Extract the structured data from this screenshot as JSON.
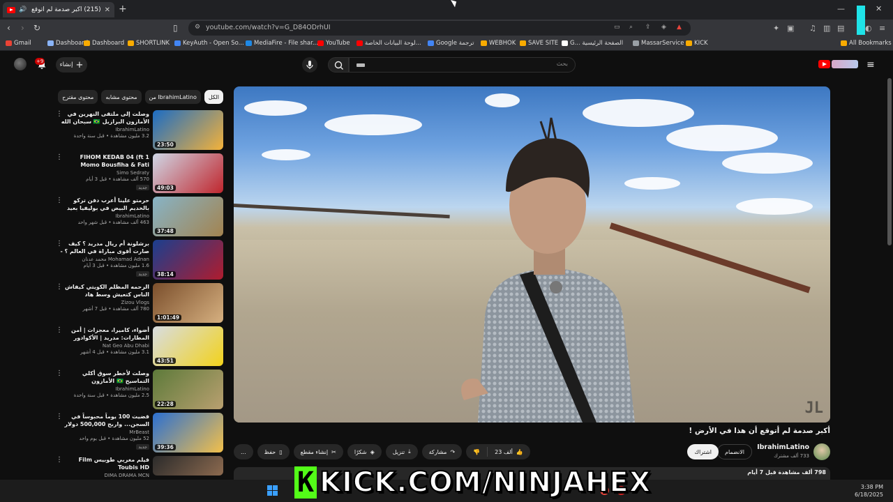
{
  "browser": {
    "tab_title": "(215) أكبر صدمة لم أتوقع أن هذا في الأرض !",
    "url": "youtube.com/watch?v=G_D84ODrhUI",
    "bookmarks": [
      {
        "label": "Gmail",
        "color": "#ea4335"
      },
      {
        "label": "Dashboard",
        "color": "#8ab4f8"
      },
      {
        "label": "Dashboard",
        "color": "#f9ab00"
      },
      {
        "label": "SHORTLINK",
        "color": "#f9ab00"
      },
      {
        "label": "KeyAuth - Open So...",
        "color": "#4285f4"
      },
      {
        "label": "MediaFire - File shar...",
        "color": "#1e88e5"
      },
      {
        "label": "YouTube",
        "color": "#ff0000"
      },
      {
        "label": "لوحة البيانات الخاصة...",
        "color": "#ff0000"
      },
      {
        "label": "Google ترجمة",
        "color": "#4285f4"
      },
      {
        "label": "WEBHOK",
        "color": "#f9ab00"
      },
      {
        "label": "SAVE SITE",
        "color": "#f9ab00"
      },
      {
        "label": "G... الصفحة الرئيسية",
        "color": "#ffffff"
      },
      {
        "label": "MassarService",
        "color": "#9aa0a6"
      },
      {
        "label": "KICK",
        "color": "#f9ab00"
      },
      {
        "label": "All Bookmarks",
        "color": "#f9ab00"
      }
    ]
  },
  "masthead": {
    "search_placeholder": "بحث",
    "create_label": "إنشاء",
    "notifications": "+9"
  },
  "chips": [
    "الكل",
    "من IbrahimLatino",
    "محتوى مشابه",
    "محتوى مقترح"
  ],
  "related": [
    {
      "title": "وصلت إلى ملتقى النهرين في الأمازون البرازيل 🇧🇷 سبحان الله",
      "channel": "IbrahimLatino",
      "stats": "3.2 مليون مشاهدة • قبل سنة واحدة",
      "duration": "23:50",
      "new": "",
      "colors": [
        "#1b6cc4",
        "#f4b23a"
      ]
    },
    {
      "title": "1 FIHOM KEDAB 04 (ft Momo Bousfiha & Fati Jamali)",
      "channel": "Simo Sedraty",
      "stats": "570 ألف مشاهدة • قبل 3 أيام",
      "duration": "49:03",
      "new": "جديد",
      "colors": [
        "#cfd7e6",
        "#c0262d"
      ]
    },
    {
      "title": "حرمتو علينا أعرب دفن تركو بالخديم البيض في بوليفيا بعيد عن البحر 🇧🇴",
      "channel": "IbrahimLatino",
      "stats": "463 ألف مشاهدة • قبل شهر واحد",
      "duration": "37:48",
      "new": "",
      "colors": [
        "#87b4c7",
        "#a3834f"
      ]
    },
    {
      "title": "برشلونة أم ريال مدريد ؟ كيف صارت أقوى مباراة في العالم ؟ - القصة الكاملة",
      "channel": "Mohamad Adnan محمد عدنان",
      "stats": "1.6 مليون مشاهدة • قبل 3 أيام",
      "duration": "38:14",
      "new": "جديد",
      "colors": [
        "#1a3f8f",
        "#b01c2e"
      ]
    },
    {
      "title": "الرحمه المظلم الكويتي كيفاش الناس كتعيش وسط هاد الظروف!!",
      "channel": "Zizou Vlogs",
      "stats": "780 ألف مشاهدة • قبل 7 أشهر",
      "duration": "1:01:49",
      "new": "",
      "colors": [
        "#7b4f2c",
        "#d6b080"
      ]
    },
    {
      "title": "أضواء، كاميرا، معجزات | أمن المطارات: مدريد | الأكوادور تيجي فريقك أبوظبي",
      "channel": "Nat Geo Abu Dhabi",
      "stats": "3.1 مليون مشاهدة • قبل 4 أشهر",
      "duration": "43:51",
      "new": "",
      "colors": [
        "#d8dde2",
        "#f2d21b"
      ]
    },
    {
      "title": "وصلت لأخطر سوق أكلي التماسيح 🇧🇷 الأمازون",
      "channel": "IbrahimLatino",
      "stats": "2.5 مليون مشاهدة • قبل سنة واحدة",
      "duration": "22:28",
      "new": "",
      "colors": [
        "#5d7a3a",
        "#b9a070"
      ]
    },
    {
      "title": "قضيت 100 يوماً محبوساً في السجن... واربح 500,000 دولار",
      "channel": "MrBeast",
      "stats": "52 مليون مشاهدة • قبل يوم واحد",
      "duration": "39:36",
      "new": "جديد",
      "colors": [
        "#2b6fd1",
        "#f3c04a"
      ]
    },
    {
      "title": "فيلم مغربي طوبيس Film Toubis HD",
      "channel": "DIMA DRAMA MCN",
      "stats": "",
      "duration": "",
      "new": "",
      "colors": [
        "#2b2b2b",
        "#8c6a4f"
      ]
    }
  ],
  "video": {
    "title": "أكبر صدمة لم أتوقع أن هذا في الأرض !",
    "channel": "IbrahimLatino",
    "subscribers": "733 ألف مشترك",
    "join_label": "الانضمام",
    "subscribe_label": "اشتراك",
    "likes": "23 ألف",
    "share_label": "مشاركة",
    "download_label": "تنزيل",
    "thanks_label": "شكرًا",
    "clip_label": "إنشاء مقطع",
    "save_label": "حفظ",
    "more_label": "...",
    "stats": "798 ألف مشاهدة  قبل 7 أيام"
  },
  "taskbar": {
    "time": "3:38 PM",
    "date": "6/18/2025"
  },
  "overlay": {
    "k": "K",
    "text": "KICK.COM/NINJAHEX"
  }
}
